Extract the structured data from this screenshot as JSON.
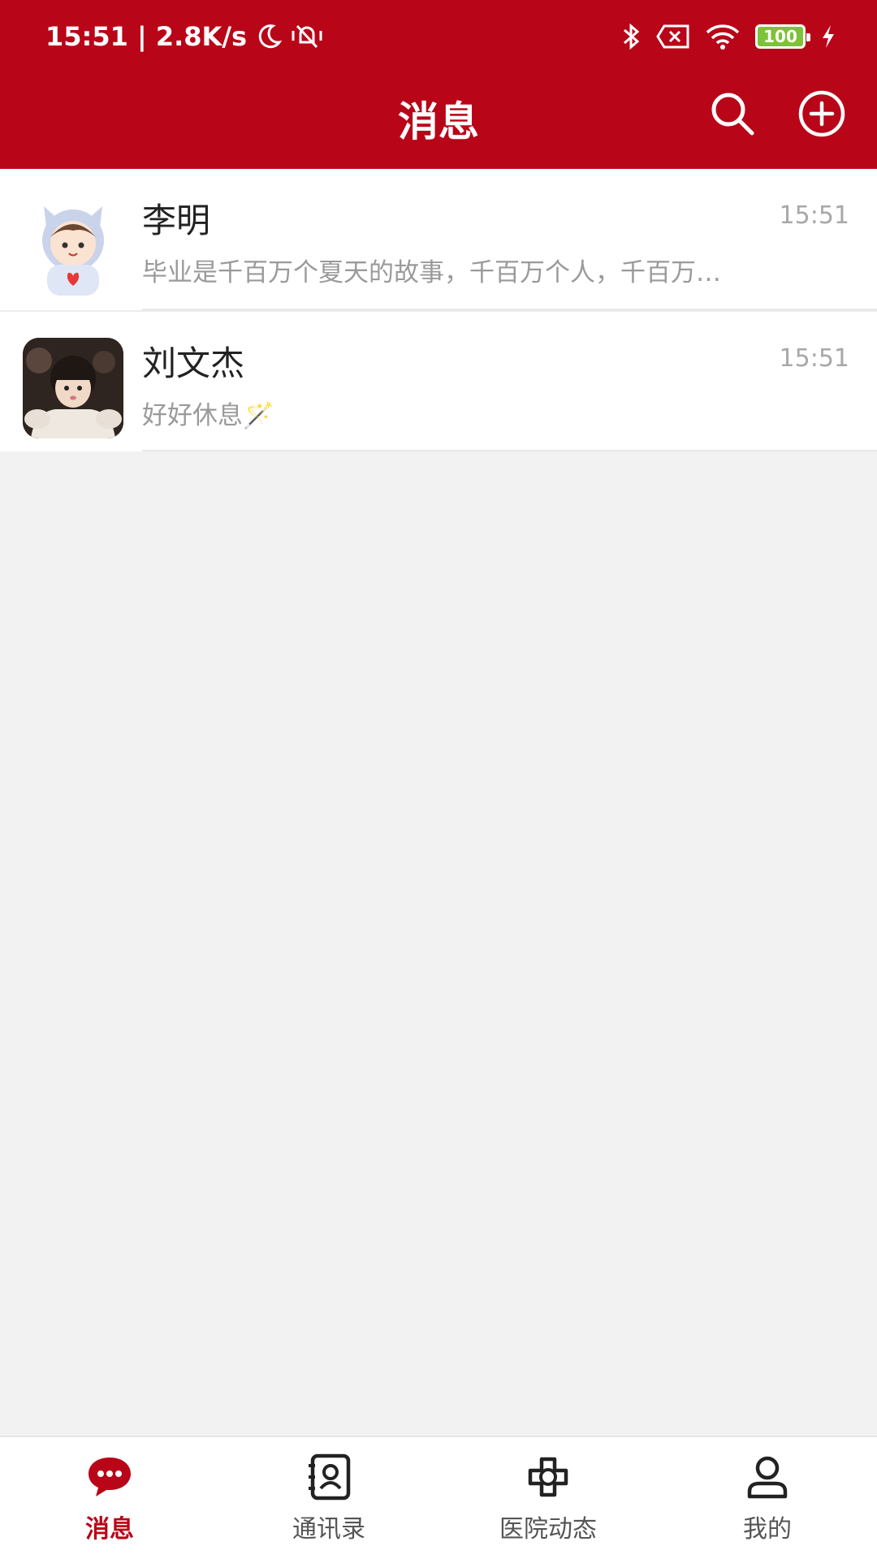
{
  "status_bar": {
    "left_text": "15:51 | 2.8K/s",
    "battery": "100",
    "icons": [
      "moon-icon",
      "mute-icon",
      "bluetooth-icon",
      "sim-off-icon",
      "wifi-icon",
      "battery-icon",
      "charging-icon"
    ]
  },
  "header": {
    "title": "消息",
    "search_icon": "search-icon",
    "add_icon": "add-circle-icon"
  },
  "colors": {
    "brand": "#b90518",
    "background": "#f2f2f2"
  },
  "conversations": [
    {
      "name": "李明",
      "time": "15:51",
      "preview": "毕业是千百万个夏天的故事，千百万个人，千百万…",
      "avatar": "cartoon-boy-avatar"
    },
    {
      "name": "刘文杰",
      "time": "15:51",
      "preview": "好好休息🪄",
      "avatar": "child-photo-avatar"
    }
  ],
  "tabs": [
    {
      "label": "消息",
      "icon": "chat-bubble-icon",
      "active": true
    },
    {
      "label": "通讯录",
      "icon": "contacts-book-icon",
      "active": false
    },
    {
      "label": "医院动态",
      "icon": "hospital-news-icon",
      "active": false
    },
    {
      "label": "我的",
      "icon": "profile-icon",
      "active": false
    }
  ]
}
